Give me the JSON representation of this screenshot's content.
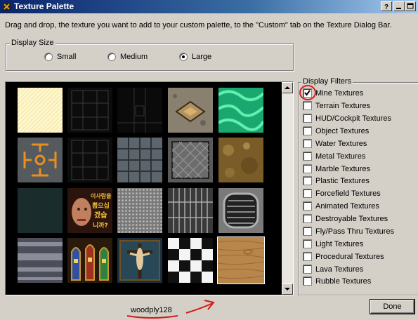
{
  "window": {
    "title": "Texture Palette"
  },
  "instruction": "Drag and drop, the texture you want to add to your custom palette, to the \"Custom\" tab on the Texture Dialog Bar.",
  "display_size": {
    "label": "Display Size",
    "options": [
      {
        "label": "Small",
        "selected": false
      },
      {
        "label": "Medium",
        "selected": false
      },
      {
        "label": "Large",
        "selected": true
      }
    ]
  },
  "filters": {
    "label": "Display Filters",
    "items": [
      {
        "label": "Mine Textures",
        "checked": true
      },
      {
        "label": "Terrain Textures",
        "checked": false
      },
      {
        "label": "HUD/Cockpit Textures",
        "checked": false
      },
      {
        "label": "Object Textures",
        "checked": false
      },
      {
        "label": "Water Textures",
        "checked": false
      },
      {
        "label": "Metal Textures",
        "checked": false
      },
      {
        "label": "Marble Textures",
        "checked": false
      },
      {
        "label": "Plastic Textures",
        "checked": false
      },
      {
        "label": "Forcefield Textures",
        "checked": false
      },
      {
        "label": "Animated Textures",
        "checked": false
      },
      {
        "label": "Destroyable Textures",
        "checked": false
      },
      {
        "label": "Fly/Pass Thru Textures",
        "checked": false
      },
      {
        "label": "Light Textures",
        "checked": false
      },
      {
        "label": "Procedural Textures",
        "checked": false
      },
      {
        "label": "Lava Textures",
        "checked": false
      },
      {
        "label": "Rubble Textures",
        "checked": false
      }
    ]
  },
  "selected_texture": "woodply128",
  "done_label": "Done",
  "poster_text": [
    "이사람을",
    "뽑으십",
    "겠습",
    "니까?"
  ],
  "annotation_color": "#d81818",
  "tiles": [
    "cream-pattern",
    "dark-panel-a",
    "dark-panel-b",
    "diamond-plate-emblem",
    "green-swirl",
    "orange-symbol",
    "dark-panel-c",
    "stone-tiles",
    "metal-mesh",
    "brown-rock",
    "dark-teal",
    "face-poster",
    "diamond-grate",
    "metal-grid",
    "floor-vent",
    "ribbed-metal",
    "stained-glass",
    "crucifix-glass",
    "checker-marble",
    "woodply128"
  ]
}
